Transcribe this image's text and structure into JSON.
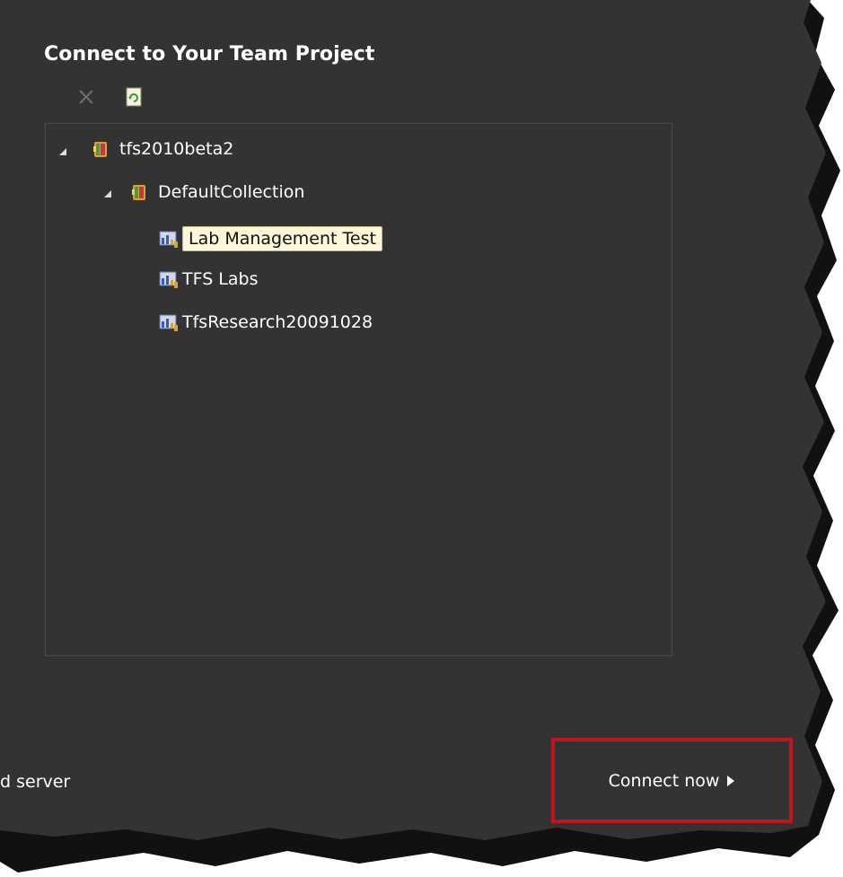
{
  "dialog": {
    "title": "Connect to Your Team Project",
    "background_color": "#333333",
    "accent_color": "#c0161a"
  },
  "toolbar": {
    "items": [
      {
        "name": "delete",
        "icon": "close-icon",
        "enabled": false
      },
      {
        "name": "refresh",
        "icon": "refresh-icon",
        "enabled": true
      }
    ]
  },
  "tree": {
    "server": {
      "label": "tfs2010beta2",
      "icon": "team-foundation-server-icon",
      "expanded": true
    },
    "collection": {
      "label": "DefaultCollection",
      "icon": "team-project-collection-icon",
      "expanded": true
    },
    "projects": [
      {
        "label": "Lab Management Test",
        "icon": "team-project-icon",
        "selected": true
      },
      {
        "label": "TFS Labs",
        "icon": "team-project-icon",
        "selected": false
      },
      {
        "label": "TfsResearch20091028",
        "icon": "team-project-icon",
        "selected": false
      }
    ]
  },
  "footer": {
    "left_text": "d server",
    "connect_label": "Connect now",
    "connect_icon": "play-arrow-icon"
  }
}
